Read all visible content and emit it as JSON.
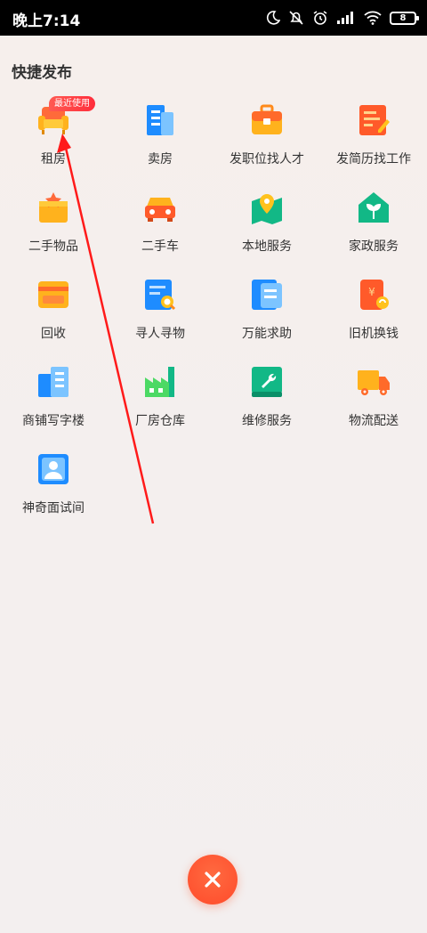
{
  "statusbar": {
    "time": "晚上7:14",
    "icons": [
      "moon-icon",
      "mute-alarm-icon",
      "alarm-clock-icon",
      "signal-icon",
      "wifi-icon",
      "battery-icon"
    ],
    "battery_level": "8"
  },
  "page": {
    "section_title": "快捷发布",
    "items": [
      {
        "label": "租房",
        "icon": "sofa-icon",
        "badge": "最近使用"
      },
      {
        "label": "卖房",
        "icon": "building-icon"
      },
      {
        "label": "发职位找人才",
        "icon": "briefcase-icon"
      },
      {
        "label": "发简历找工作",
        "icon": "resume-edit-icon"
      },
      {
        "label": "二手物品",
        "icon": "box-star-icon"
      },
      {
        "label": "二手车",
        "icon": "car-icon"
      },
      {
        "label": "本地服务",
        "icon": "map-pin-icon"
      },
      {
        "label": "家政服务",
        "icon": "house-sprout-icon"
      },
      {
        "label": "回收",
        "icon": "card-recycle-icon"
      },
      {
        "label": "寻人寻物",
        "icon": "search-document-icon"
      },
      {
        "label": "万能求助",
        "icon": "document-icon"
      },
      {
        "label": "旧机换钱",
        "icon": "phone-yuan-icon"
      },
      {
        "label": "商铺写字楼",
        "icon": "office-building-icon"
      },
      {
        "label": "厂房仓库",
        "icon": "factory-icon"
      },
      {
        "label": "维修服务",
        "icon": "wrench-icon"
      },
      {
        "label": "物流配送",
        "icon": "delivery-truck-icon"
      },
      {
        "label": "神奇面试间",
        "icon": "interview-avatar-icon"
      }
    ],
    "close_icon": "close-icon"
  },
  "colors": {
    "accent": "#ff4b2b",
    "badge": "#ff3d3d",
    "annotation_arrow": "#ff1a1a"
  }
}
